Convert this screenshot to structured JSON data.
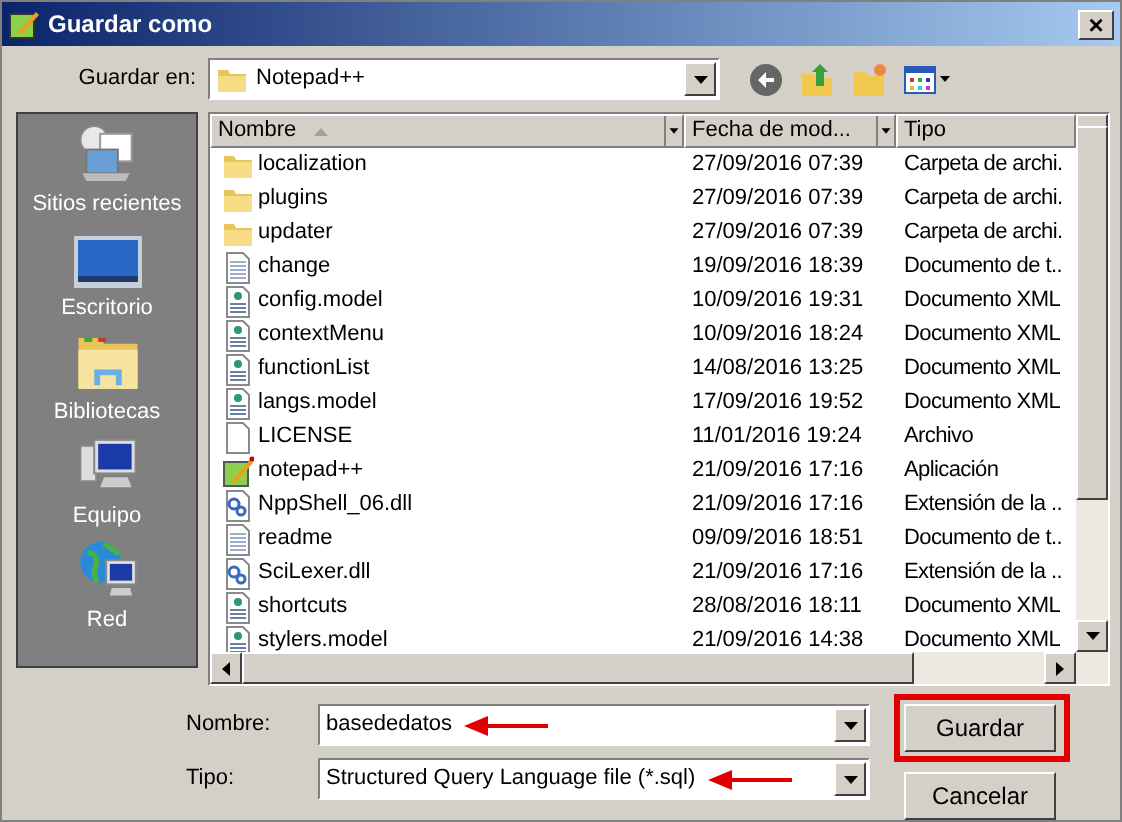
{
  "window": {
    "title": "Guardar como",
    "close": "×"
  },
  "location": {
    "label": "Guardar en:",
    "value": "Notepad++"
  },
  "sidebar": {
    "items": [
      {
        "label": "Sitios recientes",
        "kind": "recent"
      },
      {
        "label": "Escritorio",
        "kind": "desktop"
      },
      {
        "label": "Bibliotecas",
        "kind": "libraries"
      },
      {
        "label": "Equipo",
        "kind": "computer"
      },
      {
        "label": "Red",
        "kind": "network"
      }
    ]
  },
  "table": {
    "columns": [
      {
        "label": "Nombre",
        "sorted": true
      },
      {
        "label": "Fecha de mod...",
        "sorted": false
      },
      {
        "label": "Tipo",
        "sorted": false
      }
    ],
    "rows": [
      {
        "kind": "folder",
        "cells": [
          "localization",
          "27/09/2016 07:39",
          "Carpeta de archi."
        ]
      },
      {
        "kind": "folder",
        "cells": [
          "plugins",
          "27/09/2016 07:39",
          "Carpeta de archi."
        ]
      },
      {
        "kind": "folder",
        "cells": [
          "updater",
          "27/09/2016 07:39",
          "Carpeta de archi."
        ]
      },
      {
        "kind": "text",
        "cells": [
          "change",
          "19/09/2016 18:39",
          "Documento de t.."
        ]
      },
      {
        "kind": "xml",
        "cells": [
          "config.model",
          "10/09/2016 19:31",
          "Documento XML"
        ]
      },
      {
        "kind": "xml",
        "cells": [
          "contextMenu",
          "10/09/2016 18:24",
          "Documento XML"
        ]
      },
      {
        "kind": "xml",
        "cells": [
          "functionList",
          "14/08/2016 13:25",
          "Documento XML"
        ]
      },
      {
        "kind": "xml",
        "cells": [
          "langs.model",
          "17/09/2016 19:52",
          "Documento XML"
        ]
      },
      {
        "kind": "file",
        "cells": [
          "LICENSE",
          "11/01/2016 19:24",
          "Archivo"
        ]
      },
      {
        "kind": "app",
        "cells": [
          "notepad++",
          "21/09/2016 17:16",
          "Aplicación"
        ]
      },
      {
        "kind": "dll",
        "cells": [
          "NppShell_06.dll",
          "21/09/2016 17:16",
          "Extensión de la .."
        ]
      },
      {
        "kind": "text",
        "cells": [
          "readme",
          "09/09/2016 18:51",
          "Documento de t.."
        ]
      },
      {
        "kind": "dll",
        "cells": [
          "SciLexer.dll",
          "21/09/2016 17:16",
          "Extensión de la .."
        ]
      },
      {
        "kind": "xml",
        "cells": [
          "shortcuts",
          "28/08/2016 18:11",
          "Documento XML"
        ]
      },
      {
        "kind": "xml",
        "cells": [
          "stylers.model",
          "21/09/2016 14:38",
          "Documento XML"
        ]
      }
    ]
  },
  "filename": {
    "label": "Nombre:",
    "value": "basededatos"
  },
  "filetype": {
    "label": "Tipo:",
    "value": "Structured Query Language file (*.sql)"
  },
  "buttons": [
    {
      "label": "Guardar",
      "highlighted": true
    },
    {
      "label": "Cancelar",
      "highlighted": false
    }
  ]
}
